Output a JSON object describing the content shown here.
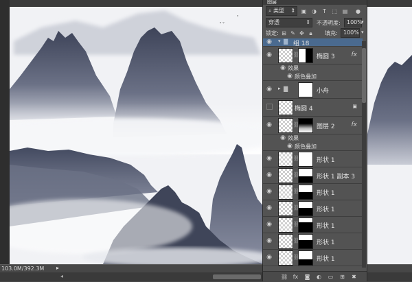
{
  "panel": {
    "tab_title": "图层",
    "filter": {
      "label": "类型"
    },
    "blend_mode": "穿透",
    "opacity": {
      "label": "不透明度:",
      "value": "100%"
    },
    "lock": {
      "label": "锁定:"
    },
    "fill": {
      "label": "填充:",
      "value": "100%"
    },
    "layers": [
      {
        "name": "组 18",
        "type": "group",
        "expanded": true
      },
      {
        "name": "椭圆 3",
        "type": "layer",
        "has_fx": true
      },
      {
        "name": "效果",
        "type": "effect-header"
      },
      {
        "name": "颜色叠加",
        "type": "effect"
      },
      {
        "name": "小舟",
        "type": "group",
        "expanded": false
      },
      {
        "name": "椭圆 4",
        "type": "layer",
        "locked": true,
        "hidden": true
      },
      {
        "name": "图层 2",
        "type": "layer",
        "has_fx": true
      },
      {
        "name": "效果",
        "type": "effect-header"
      },
      {
        "name": "颜色叠加",
        "type": "effect"
      },
      {
        "name": "形状 1",
        "type": "shape"
      },
      {
        "name": "形状 1 副本 3",
        "type": "shape"
      },
      {
        "name": "形状 1",
        "type": "shape"
      },
      {
        "name": "形状 1",
        "type": "shape"
      },
      {
        "name": "形状 1",
        "type": "shape"
      },
      {
        "name": "形状 1",
        "type": "shape"
      },
      {
        "name": "形状 1",
        "type": "shape"
      }
    ],
    "fx_label": "fx"
  },
  "status": {
    "doc_size": "103.0M/392.3M"
  },
  "colors": {
    "panel_bg": "#535353",
    "selected": "#4a6a8f",
    "canvas_bg": "#f2f3f6",
    "mountain": "#4a5168"
  }
}
